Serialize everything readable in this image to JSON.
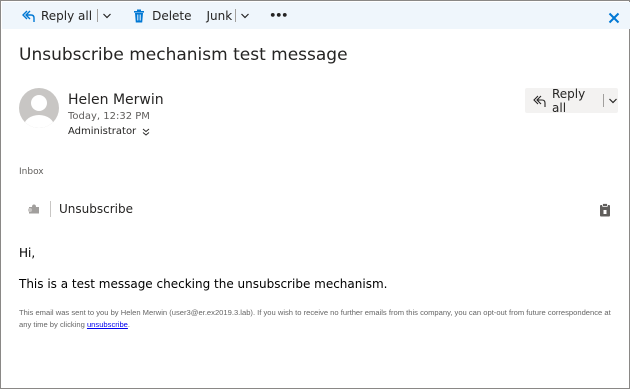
{
  "toolbar": {
    "reply_all_label": "Reply all",
    "delete_label": "Delete",
    "junk_label": "Junk",
    "more_label": "•••"
  },
  "message": {
    "subject": "Unsubscribe mechanism test message",
    "sender_name": "Helen Merwin",
    "date": "Today, 12:32 PM",
    "recipient": "Administrator",
    "reply_all_label": "Reply all",
    "folder": "Inbox"
  },
  "unsubscribe_bar": {
    "label": "Unsubscribe"
  },
  "body": {
    "greeting": "Hi,",
    "line1": "This is a test message checking the unsubscribe mechanism.",
    "footer_text": "This email was sent to you by Helen Merwin (user3@er.ex2019.3.lab). If you wish to receive no further emails from this company, you can opt-out from future correspondence at any time by clicking ",
    "footer_link": "unsubscribe",
    "footer_end": "."
  },
  "colors": {
    "toolbar_bg": "#eff6fc",
    "accent": "#0078d4",
    "link": "#0000ee"
  }
}
